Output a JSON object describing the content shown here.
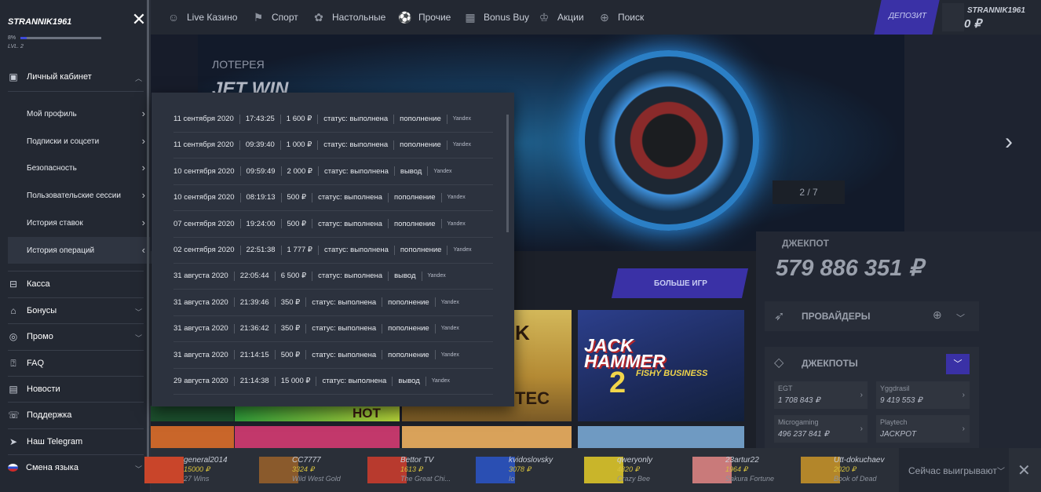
{
  "sidebar": {
    "username": "STRANNIK1961",
    "progress_label": "8%",
    "progress": 0.08,
    "level": "LVL. 2",
    "cabinet": {
      "label": "Личный кабинет",
      "items": [
        "Мой профиль",
        "Подписки и соцсети",
        "Безопасность",
        "Пользовательские сессии",
        "История ставок",
        "История операций"
      ]
    },
    "menu": [
      "Касса",
      "Бонусы",
      "Промо",
      "FAQ",
      "Новости",
      "Поддержка",
      "Наш Telegram",
      "Смена языка"
    ]
  },
  "nav": {
    "items": [
      "Live Казино",
      "Спорт",
      "Настольные",
      "Прочие",
      "Bonus Buy",
      "Акции",
      "Поиск"
    ],
    "deposit": "ДЕПОЗИТ",
    "user": {
      "name": "STRANNIK1961",
      "balance": "0 ₽"
    }
  },
  "banner": {
    "category": "ЛОТЕРЕЯ",
    "title": "JET WIN",
    "counter": "2 / 7"
  },
  "jackpot": {
    "label": "ДЖЕКПОТ",
    "amount": "579 886 351 ₽",
    "providers_label": "ПРОВАЙДЕРЫ",
    "jackpots_label": "ДЖЕКПОТЫ",
    "items": [
      {
        "name": "EGT",
        "value": "1 708 843 ₽"
      },
      {
        "name": "Yggdrasil",
        "value": "9 419 553 ₽"
      },
      {
        "name": "Microgaming",
        "value": "496 237 841 ₽"
      },
      {
        "name": "Playtech",
        "value": "JACKPOT"
      }
    ]
  },
  "more_games": "БОЛЬШЕ ИГР",
  "tiles": {
    "jack_line1": "JACK",
    "jack_line2": "HAMMER",
    "jack_num": "2",
    "jack_sub": "FISHY BUSINESS",
    "aztec_top": "K",
    "aztec_bottom": "TEC",
    "hot": "HOT"
  },
  "operations": [
    {
      "date": "11 сентября 2020",
      "time": "17:43:25",
      "amount": "1 600 ₽",
      "status": "статус: выполнена",
      "type": "пополнение",
      "bank": "Yandex"
    },
    {
      "date": "11 сентября 2020",
      "time": "09:39:40",
      "amount": "1 000 ₽",
      "status": "статус: выполнена",
      "type": "пополнение",
      "bank": "Yandex"
    },
    {
      "date": "10 сентября 2020",
      "time": "09:59:49",
      "amount": "2 000 ₽",
      "status": "статус: выполнена",
      "type": "вывод",
      "bank": "Yandex"
    },
    {
      "date": "10 сентября 2020",
      "time": "08:19:13",
      "amount": "500 ₽",
      "status": "статус: выполнена",
      "type": "пополнение",
      "bank": "Yandex"
    },
    {
      "date": "07 сентября 2020",
      "time": "19:24:00",
      "amount": "500 ₽",
      "status": "статус: выполнена",
      "type": "пополнение",
      "bank": "Yandex"
    },
    {
      "date": "02 сентября 2020",
      "time": "22:51:38",
      "amount": "1 777 ₽",
      "status": "статус: выполнена",
      "type": "пополнение",
      "bank": "Yandex"
    },
    {
      "date": "31 августа 2020",
      "time": "22:05:44",
      "amount": "6 500 ₽",
      "status": "статус: выполнена",
      "type": "вывод",
      "bank": "Yandex"
    },
    {
      "date": "31 августа 2020",
      "time": "21:39:46",
      "amount": "350 ₽",
      "status": "статус: выполнена",
      "type": "пополнение",
      "bank": "Yandex"
    },
    {
      "date": "31 августа 2020",
      "time": "21:36:42",
      "amount": "350 ₽",
      "status": "статус: выполнена",
      "type": "пополнение",
      "bank": "Yandex"
    },
    {
      "date": "31 августа 2020",
      "time": "21:14:15",
      "amount": "500 ₽",
      "status": "статус: выполнена",
      "type": "пополнение",
      "bank": "Yandex"
    },
    {
      "date": "29 августа 2020",
      "time": "21:14:38",
      "amount": "15 000 ₽",
      "status": "статус: выполнена",
      "type": "вывод",
      "bank": "Yandex"
    }
  ],
  "winners": [
    {
      "name": "general2014",
      "amount": "15000 ₽",
      "game": "27 Wins",
      "color": "#c9452a"
    },
    {
      "name": "CC7777",
      "amount": "3324 ₽",
      "game": "Wild West Gold",
      "color": "#8a5a2c"
    },
    {
      "name": "Bettor TV",
      "amount": "1613 ₽",
      "game": "The Great Chi...",
      "color": "#b83a2e"
    },
    {
      "name": "kvidoslovsky",
      "amount": "3078 ₽",
      "game": "Io",
      "color": "#2a4fb3"
    },
    {
      "name": "qweryonly",
      "amount": "4820 ₽",
      "game": "Crazy Bee",
      "color": "#c9b52a"
    },
    {
      "name": "23artur22",
      "amount": "1964 ₽",
      "game": "Sakura Fortune",
      "color": "#c97a7a"
    },
    {
      "name": "Utt-dokuchaev",
      "amount": "2020 ₽",
      "game": "Book of Dead",
      "color": "#b3862a"
    }
  ],
  "now_winning": "Сейчас выигрывают"
}
